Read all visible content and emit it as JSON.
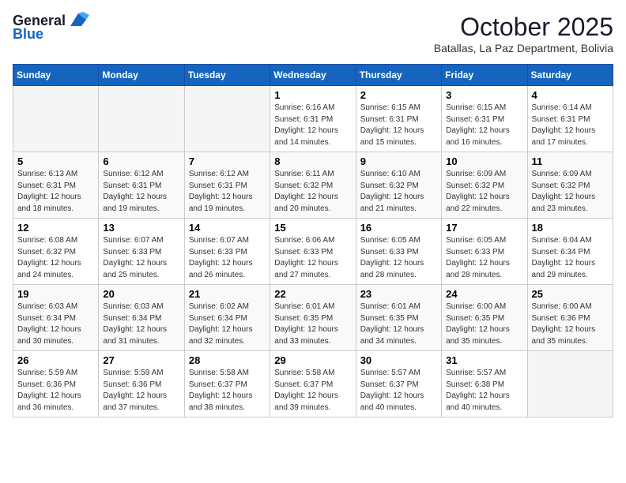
{
  "logo": {
    "general": "General",
    "blue": "Blue"
  },
  "header": {
    "month": "October 2025",
    "location": "Batallas, La Paz Department, Bolivia"
  },
  "weekdays": [
    "Sunday",
    "Monday",
    "Tuesday",
    "Wednesday",
    "Thursday",
    "Friday",
    "Saturday"
  ],
  "weeks": [
    [
      {
        "day": "",
        "info": ""
      },
      {
        "day": "",
        "info": ""
      },
      {
        "day": "",
        "info": ""
      },
      {
        "day": "1",
        "info": "Sunrise: 6:16 AM\nSunset: 6:31 PM\nDaylight: 12 hours\nand 14 minutes."
      },
      {
        "day": "2",
        "info": "Sunrise: 6:15 AM\nSunset: 6:31 PM\nDaylight: 12 hours\nand 15 minutes."
      },
      {
        "day": "3",
        "info": "Sunrise: 6:15 AM\nSunset: 6:31 PM\nDaylight: 12 hours\nand 16 minutes."
      },
      {
        "day": "4",
        "info": "Sunrise: 6:14 AM\nSunset: 6:31 PM\nDaylight: 12 hours\nand 17 minutes."
      }
    ],
    [
      {
        "day": "5",
        "info": "Sunrise: 6:13 AM\nSunset: 6:31 PM\nDaylight: 12 hours\nand 18 minutes."
      },
      {
        "day": "6",
        "info": "Sunrise: 6:12 AM\nSunset: 6:31 PM\nDaylight: 12 hours\nand 19 minutes."
      },
      {
        "day": "7",
        "info": "Sunrise: 6:12 AM\nSunset: 6:31 PM\nDaylight: 12 hours\nand 19 minutes."
      },
      {
        "day": "8",
        "info": "Sunrise: 6:11 AM\nSunset: 6:32 PM\nDaylight: 12 hours\nand 20 minutes."
      },
      {
        "day": "9",
        "info": "Sunrise: 6:10 AM\nSunset: 6:32 PM\nDaylight: 12 hours\nand 21 minutes."
      },
      {
        "day": "10",
        "info": "Sunrise: 6:09 AM\nSunset: 6:32 PM\nDaylight: 12 hours\nand 22 minutes."
      },
      {
        "day": "11",
        "info": "Sunrise: 6:09 AM\nSunset: 6:32 PM\nDaylight: 12 hours\nand 23 minutes."
      }
    ],
    [
      {
        "day": "12",
        "info": "Sunrise: 6:08 AM\nSunset: 6:32 PM\nDaylight: 12 hours\nand 24 minutes."
      },
      {
        "day": "13",
        "info": "Sunrise: 6:07 AM\nSunset: 6:33 PM\nDaylight: 12 hours\nand 25 minutes."
      },
      {
        "day": "14",
        "info": "Sunrise: 6:07 AM\nSunset: 6:33 PM\nDaylight: 12 hours\nand 26 minutes."
      },
      {
        "day": "15",
        "info": "Sunrise: 6:06 AM\nSunset: 6:33 PM\nDaylight: 12 hours\nand 27 minutes."
      },
      {
        "day": "16",
        "info": "Sunrise: 6:05 AM\nSunset: 6:33 PM\nDaylight: 12 hours\nand 28 minutes."
      },
      {
        "day": "17",
        "info": "Sunrise: 6:05 AM\nSunset: 6:33 PM\nDaylight: 12 hours\nand 28 minutes."
      },
      {
        "day": "18",
        "info": "Sunrise: 6:04 AM\nSunset: 6:34 PM\nDaylight: 12 hours\nand 29 minutes."
      }
    ],
    [
      {
        "day": "19",
        "info": "Sunrise: 6:03 AM\nSunset: 6:34 PM\nDaylight: 12 hours\nand 30 minutes."
      },
      {
        "day": "20",
        "info": "Sunrise: 6:03 AM\nSunset: 6:34 PM\nDaylight: 12 hours\nand 31 minutes."
      },
      {
        "day": "21",
        "info": "Sunrise: 6:02 AM\nSunset: 6:34 PM\nDaylight: 12 hours\nand 32 minutes."
      },
      {
        "day": "22",
        "info": "Sunrise: 6:01 AM\nSunset: 6:35 PM\nDaylight: 12 hours\nand 33 minutes."
      },
      {
        "day": "23",
        "info": "Sunrise: 6:01 AM\nSunset: 6:35 PM\nDaylight: 12 hours\nand 34 minutes."
      },
      {
        "day": "24",
        "info": "Sunrise: 6:00 AM\nSunset: 6:35 PM\nDaylight: 12 hours\nand 35 minutes."
      },
      {
        "day": "25",
        "info": "Sunrise: 6:00 AM\nSunset: 6:36 PM\nDaylight: 12 hours\nand 35 minutes."
      }
    ],
    [
      {
        "day": "26",
        "info": "Sunrise: 5:59 AM\nSunset: 6:36 PM\nDaylight: 12 hours\nand 36 minutes."
      },
      {
        "day": "27",
        "info": "Sunrise: 5:59 AM\nSunset: 6:36 PM\nDaylight: 12 hours\nand 37 minutes."
      },
      {
        "day": "28",
        "info": "Sunrise: 5:58 AM\nSunset: 6:37 PM\nDaylight: 12 hours\nand 38 minutes."
      },
      {
        "day": "29",
        "info": "Sunrise: 5:58 AM\nSunset: 6:37 PM\nDaylight: 12 hours\nand 39 minutes."
      },
      {
        "day": "30",
        "info": "Sunrise: 5:57 AM\nSunset: 6:37 PM\nDaylight: 12 hours\nand 40 minutes."
      },
      {
        "day": "31",
        "info": "Sunrise: 5:57 AM\nSunset: 6:38 PM\nDaylight: 12 hours\nand 40 minutes."
      },
      {
        "day": "",
        "info": ""
      }
    ]
  ]
}
